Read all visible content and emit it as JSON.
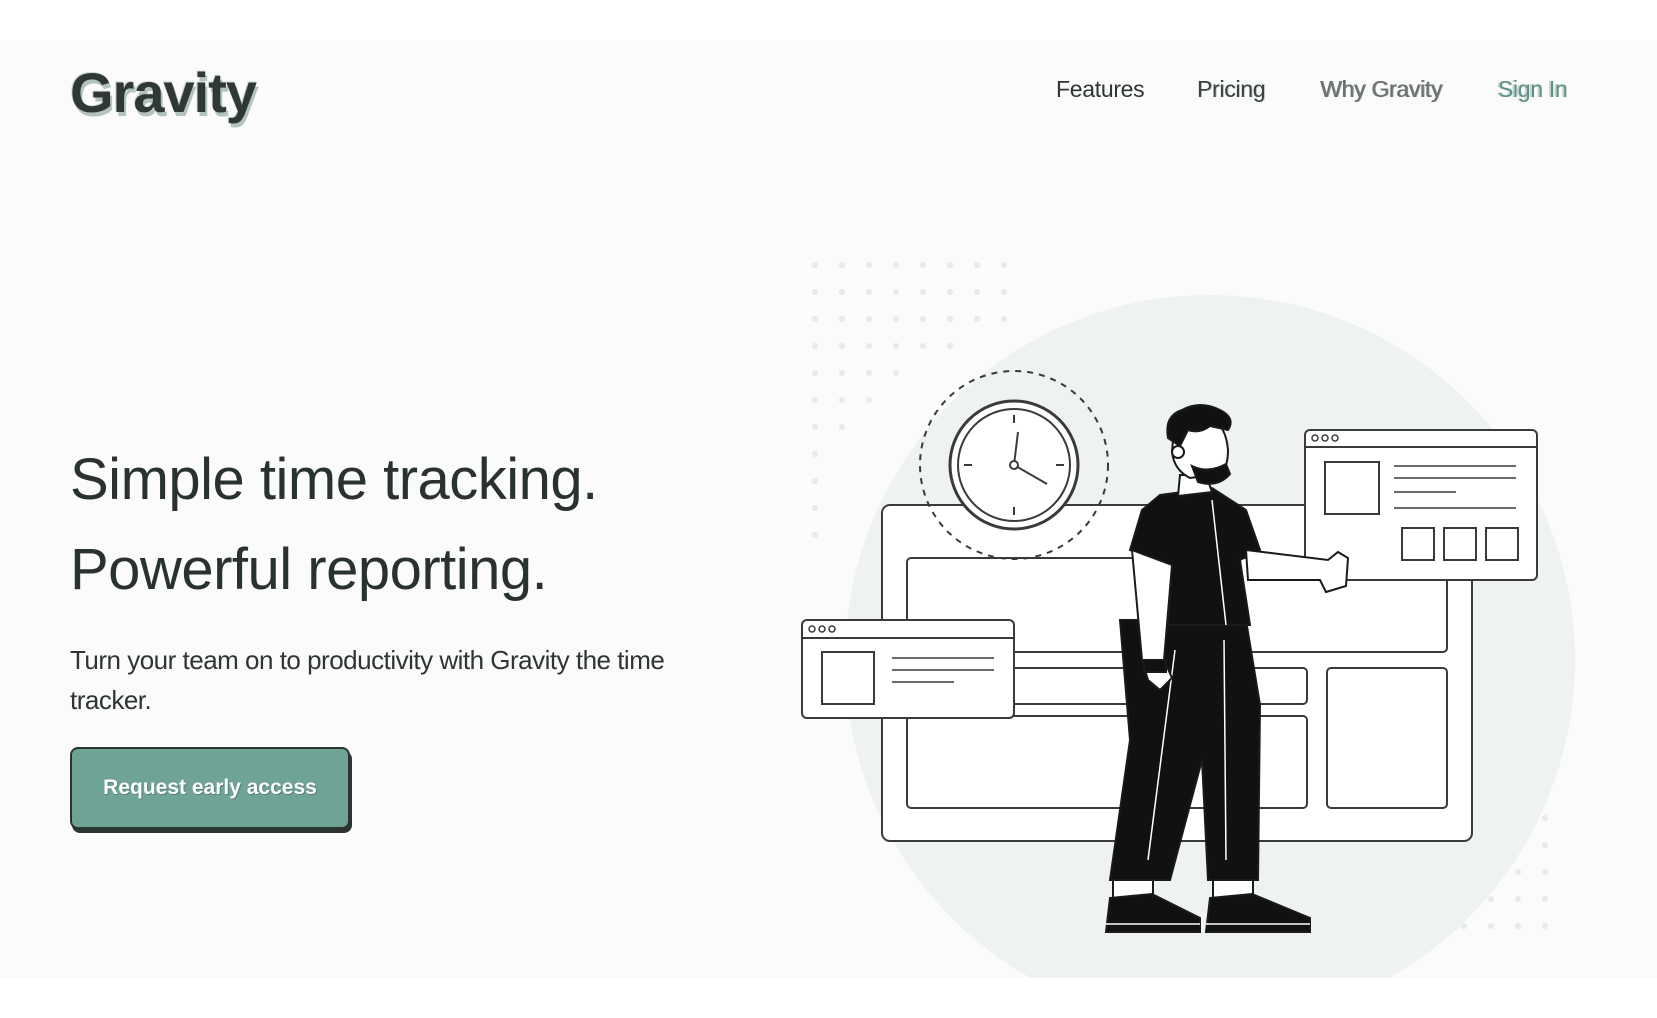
{
  "brand": {
    "logo_text": "Gravity"
  },
  "nav": {
    "items": [
      "Features",
      "Pricing",
      "Why Gravity"
    ],
    "sign_in": "Sign In"
  },
  "hero": {
    "title_line1": "Simple time tracking.",
    "title_line2": "Powerful reporting.",
    "subtitle": "Turn your team on to productivity with Gravity the time tracker.",
    "cta_label": "Request early access"
  },
  "colors": {
    "accent": "#6ea396",
    "text": "#2a322f",
    "background": "#fafbfa"
  },
  "illustration": {
    "icons": [
      "clock-icon",
      "browser-window-icon",
      "person-figure"
    ]
  }
}
